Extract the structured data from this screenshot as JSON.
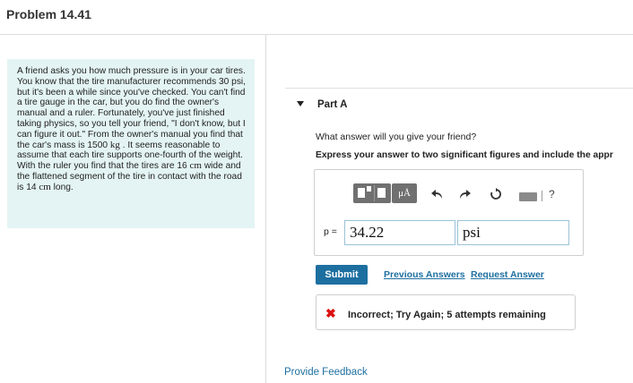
{
  "page": {
    "title": "Problem 14.41"
  },
  "problem": {
    "text_a": "A friend asks you how much pressure is in your car tires. You know that the tire manufacturer recommends 30 psi, but it's been a while since you've checked. You can't find a tire gauge in the car, but you do find the owner's manual and a ruler. Fortunately, you've just finished taking physics, so you tell your friend, \"I don't know, but I can figure it out.\" From the owner's manual you find that the car's mass is 1500 ",
    "unit_kg": "kg",
    "text_b": " . It seems reasonable to assume that each tire supports one-fourth of the weight. With the ruler you find that the tires are 16 ",
    "unit_cm1": "cm",
    "text_c": " wide and the flattened segment of the tire in contact with the road is 14 ",
    "unit_cm2": "cm",
    "text_d": " long."
  },
  "part": {
    "label": "Part A",
    "question": "What answer will you give your friend?",
    "instruction": "Express your answer to two significant figures and include the appr"
  },
  "toolbar": {
    "units_label": "μÅ",
    "help_label": "?"
  },
  "answer": {
    "variable_label": "p =",
    "value": "34.22",
    "unit": "psi"
  },
  "actions": {
    "submit_label": "Submit",
    "previous_answers_label": "Previous Answers",
    "request_answer_label": "Request Answer"
  },
  "feedback": {
    "icon": "✖",
    "message": "Incorrect; Try Again; 5 attempts remaining"
  },
  "footer": {
    "provide_feedback_label": "Provide Feedback"
  },
  "colors": {
    "accent": "#1d6fa0",
    "problem_bg": "#e4f4f4",
    "error": "#dd1111"
  }
}
